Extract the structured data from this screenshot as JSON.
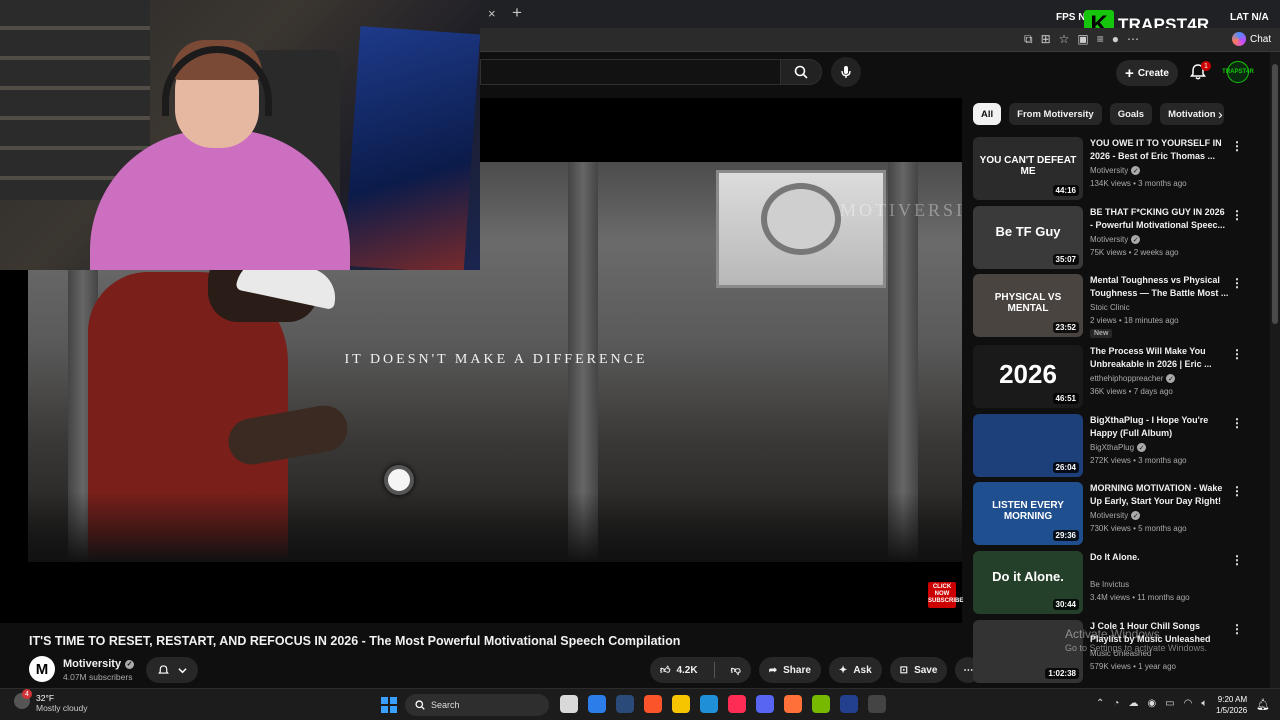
{
  "browser": {
    "close_tab": "×",
    "new_tab": "+",
    "fps_label": "FPS",
    "fps_value": "N",
    "overlay_logo_text": "TRAPST4R",
    "overlay_logo_letter": "K",
    "lat_label": "LAT",
    "lat_value": "N/A",
    "chat_label": "Chat"
  },
  "header": {
    "create_label": "Create",
    "notification_count": "1",
    "avatar_text": "TRAPST4R"
  },
  "player": {
    "caption": "IT DOESN'T MAKE A DIFFERENCE",
    "watermark": "MOTIVERSITY",
    "subscribe_badge": "CLICK NOW SUBSCRIBE"
  },
  "video": {
    "title": "IT'S TIME TO RESET, RESTART, AND REFOCUS IN 2026 - The Most Powerful Motivational Speech Compilation",
    "channel": "Motiversity",
    "channel_initial": "M",
    "subscribers": "4.07M subscribers",
    "likes": "4.2K",
    "share_label": "Share",
    "ask_label": "Ask",
    "save_label": "Save"
  },
  "chips": [
    "All",
    "From Motiversity",
    "Goals",
    "Motivation"
  ],
  "recommendations": [
    {
      "title": "YOU OWE IT TO YOURSELF IN 2026 - Best of Eric Thomas ...",
      "channel": "Motiversity",
      "verified": true,
      "meta": "134K views • 3 months ago",
      "duration": "44:16",
      "thumb_text": "YOU CAN'T DEFEAT ME",
      "thumb_bg": "#2b2b2b",
      "is_new": false
    },
    {
      "title": "BE THAT F*CKING GUY IN 2026 - Powerful Motivational Speec...",
      "channel": "Motiversity",
      "verified": true,
      "meta": "75K views • 2 weeks ago",
      "duration": "35:07",
      "thumb_text": "Be TF Guy",
      "thumb_bg": "#3a3a3a",
      "is_new": false
    },
    {
      "title": "Mental Toughness vs Physical Toughness — The Battle Most ...",
      "channel": "Stoic Clinic",
      "verified": false,
      "meta": "2 views • 18 minutes ago",
      "duration": "23:52",
      "thumb_text": "PHYSICAL VS MENTAL",
      "thumb_bg": "#4a4440",
      "is_new": true,
      "new_label": "New"
    },
    {
      "title": "The Process Will Make You Unbreakable in 2026 | Eric ...",
      "channel": "etthehiphoppreacher",
      "verified": true,
      "meta": "36K views • 7 days ago",
      "duration": "46:51",
      "thumb_text": "2026",
      "thumb_bg": "#1a1a1a",
      "is_new": false
    },
    {
      "title": "BigXthaPlug - I Hope You're Happy (Full Album)",
      "channel": "BigXthaPlug",
      "verified": true,
      "meta": "272K views • 3 months ago",
      "duration": "26:04",
      "thumb_text": "",
      "thumb_bg": "#1d3f7a",
      "is_new": false
    },
    {
      "title": "MORNING MOTIVATION - Wake Up Early, Start Your Day Right! ...",
      "channel": "Motiversity",
      "verified": true,
      "meta": "730K views • 5 months ago",
      "duration": "29:36",
      "thumb_text": "LISTEN EVERY MORNING",
      "thumb_bg": "#1f4f8f",
      "is_new": false
    },
    {
      "title": "Do It Alone.",
      "channel": "Be Invictus",
      "verified": false,
      "meta": "3.4M views • 11 months ago",
      "duration": "30:44",
      "thumb_text": "Do it Alone.",
      "thumb_bg": "#25402a",
      "is_new": false
    },
    {
      "title": "J Cole 1 Hour Chill Songs Playlist by Music Unleashed",
      "channel": "Music Unleashed",
      "verified": false,
      "meta": "579K views • 1 year ago",
      "duration": "1:02:38",
      "thumb_text": "",
      "thumb_bg": "#333333",
      "is_new": false
    }
  ],
  "windows_watermark": {
    "line1": "Activate Windows",
    "line2": "Go to Settings to activate Windows."
  },
  "taskbar": {
    "temperature": "32°F",
    "condition": "Mostly cloudy",
    "weather_badge": "4",
    "search_placeholder": "Search",
    "time": "9:20 AM",
    "date": "1/5/2026",
    "app_colors": [
      "#d9d9d9",
      "#2b7de9",
      "#2a4a7a",
      "#fb542b",
      "#f7c500",
      "#1f8fd8",
      "#ff2d55",
      "#5865f2",
      "#ff7139",
      "#76b900",
      "#23408e",
      "#444444"
    ]
  },
  "colors": {
    "background": "#0f0f0f",
    "accent_red": "#cc0000",
    "overlay_green": "#16c60c"
  }
}
